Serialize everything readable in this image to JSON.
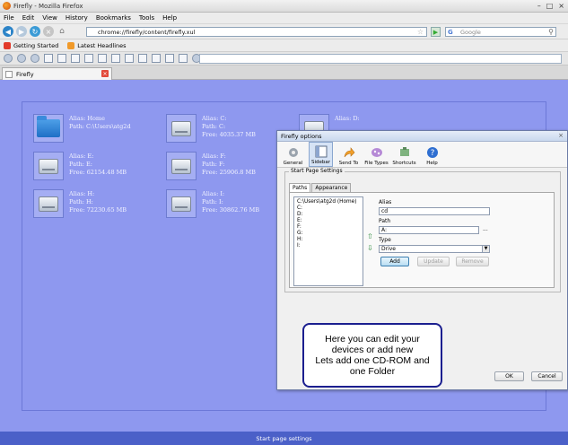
{
  "window": {
    "title": "Firefly - Mozilla Firefox"
  },
  "menu": [
    "File",
    "Edit",
    "View",
    "History",
    "Bookmarks",
    "Tools",
    "Help"
  ],
  "nav": {
    "url": "chrome://firefly/content/firefly.xul",
    "search_placeholder": "Google"
  },
  "bookmarks": [
    "Getting Started",
    "Latest Headlines"
  ],
  "tab": {
    "label": "Firefly"
  },
  "devices": [
    {
      "alias": "Alias: Home",
      "path": "Path: C:\\Users\\atg2d",
      "free": "",
      "kind": "folder-icon"
    },
    {
      "alias": "Alias: C:",
      "path": "Path: C:",
      "free": "Free: 4035.37 MB",
      "kind": "drive-icon"
    },
    {
      "alias": "Alias: D:",
      "path": "",
      "free": "",
      "kind": "drive-icon"
    },
    {
      "alias": "Alias: E:",
      "path": "Path: E:",
      "free": "Free: 62154.48 MB",
      "kind": "drive-icon"
    },
    {
      "alias": "Alias: F:",
      "path": "Path: F:",
      "free": "Free: 25906.8 MB",
      "kind": "drive-icon"
    },
    {
      "alias": "Alias: H:",
      "path": "Path: H:",
      "free": "Free: 72230.65 MB",
      "kind": "drive-icon"
    },
    {
      "alias": "Alias: I:",
      "path": "Path: I:",
      "free": "Free: 30862.76 MB",
      "kind": "drive-icon"
    }
  ],
  "status": "Start page settings",
  "dialog": {
    "title": "Firefly options",
    "toolbar": [
      "General",
      "Sidebar",
      "Send To",
      "File Types",
      "Shortcuts",
      "Help"
    ],
    "group_label": "Start Page Settings",
    "tabs": [
      "Paths",
      "Appearance"
    ],
    "list": [
      "C:\\Users\\atg2d (Home)",
      "C:",
      "D:",
      "E:",
      "F:",
      "G:",
      "H:",
      "I:"
    ],
    "alias_label": "Alias",
    "alias_value": "cd",
    "path_label": "Path",
    "path_value": "A:",
    "browse": "...",
    "type_label": "Type",
    "type_value": "Drive",
    "add": "Add",
    "update": "Update",
    "remove": "Remove",
    "ok": "OK",
    "cancel": "Cancel"
  },
  "callout": "Here you can  edit your devices or add new\nLets add one CD-ROM and one Folder"
}
